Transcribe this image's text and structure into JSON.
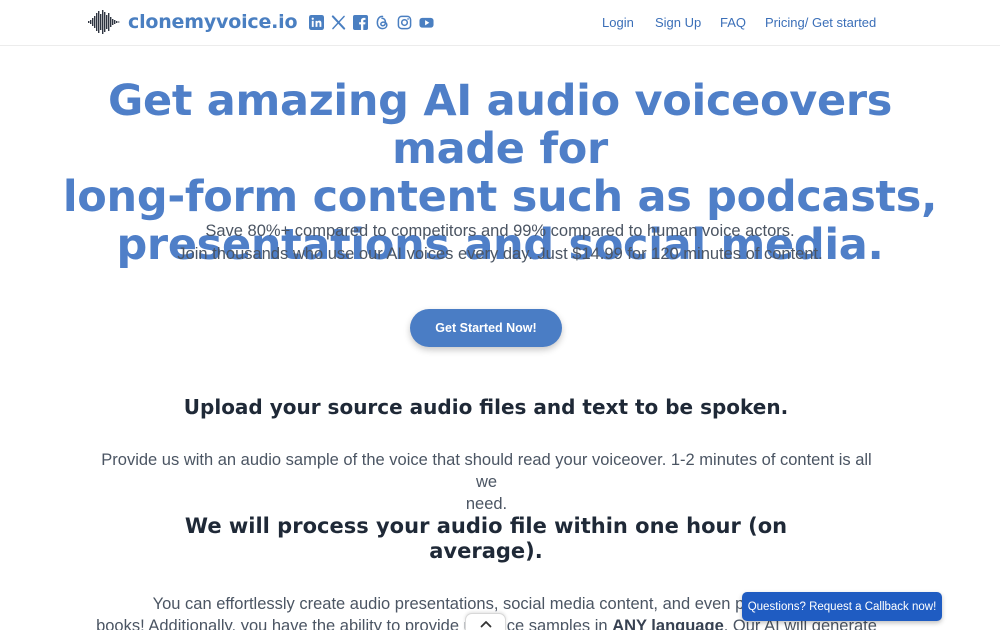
{
  "brand": {
    "name": "clonemyvoice.io",
    "logo_icon": "soundwave-icon",
    "color": "#4a7fc1"
  },
  "socials": [
    {
      "name": "linkedin-icon"
    },
    {
      "name": "x-icon"
    },
    {
      "name": "facebook-icon"
    },
    {
      "name": "threads-icon"
    },
    {
      "name": "instagram-icon"
    },
    {
      "name": "youtube-icon"
    }
  ],
  "nav": {
    "login": "Login",
    "signup": "Sign Up",
    "faq": "FAQ",
    "pricing": "Pricing/ Get started"
  },
  "hero": {
    "title_line1": "Get amazing AI audio voiceovers made for",
    "title_line2": "long-form content such as podcasts,",
    "title_line3": "presentations and social media.",
    "sub_line1": "Save 80%+ compared to competitors and 99% compared to human voice actors.",
    "sub_line2": "Join thousands who use our AI voices every day. Just $14.99 for 120 minutes of content.",
    "cta": "Get Started Now!"
  },
  "section_upload": {
    "heading": "Upload your source audio files and text to be spoken.",
    "body_line1": "Provide us with an audio sample of the voice that should read your voiceover. 1-2 minutes of content is all we",
    "body_line2": "need."
  },
  "section_process": {
    "heading_line1": "We will process your audio file within one hour (on",
    "heading_line2": "average).",
    "body_line1": "You can effortlessly create audio presentations, social media content, and even podcasts or",
    "body_line2_a": "books! Additionally, you have the ability to provide us",
    "body_line2_b": "voice samples in",
    "body_line2_bold": "ANY language",
    "body_line2_c": ". Our AI will generate"
  },
  "widgets": {
    "scroll_up_icon": "chevron-up-icon",
    "callback": "Questions? Request a Callback now!"
  },
  "colors": {
    "accent": "#4a7dc5",
    "hero_title": "#4f7fc8",
    "heading": "#1f2937",
    "callback_bg": "#1f5cc2"
  }
}
